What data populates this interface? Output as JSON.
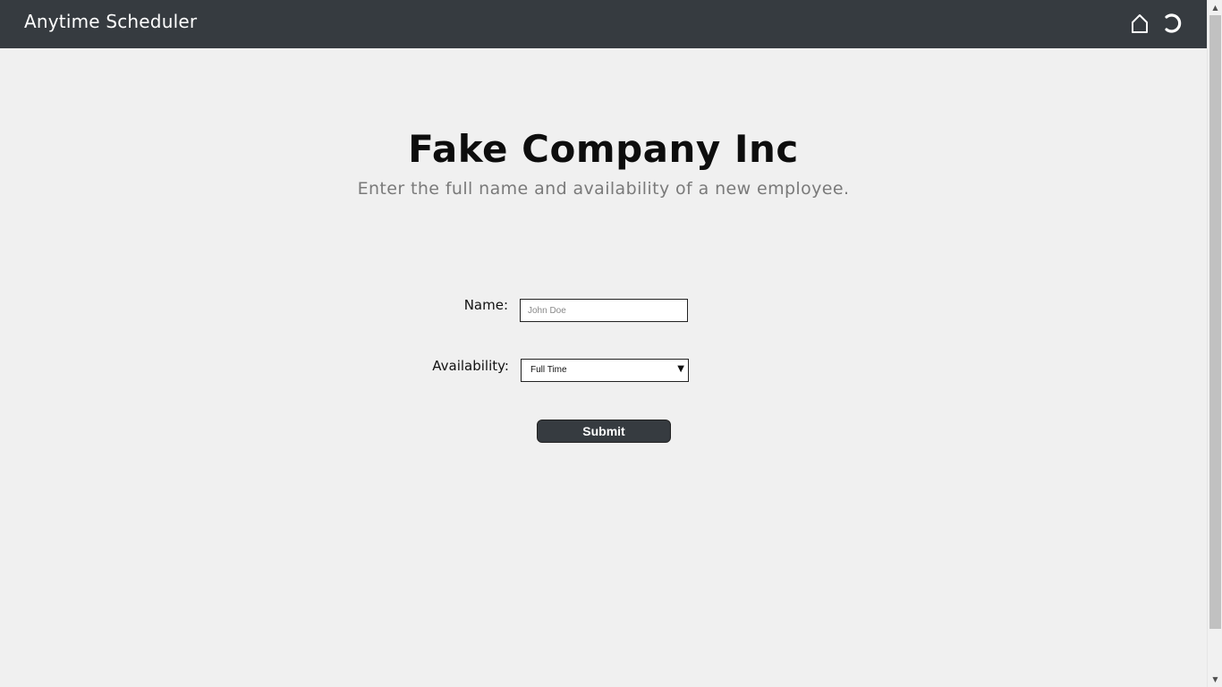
{
  "navbar": {
    "brand": "Anytime Scheduler",
    "icons": [
      "home-icon",
      "logout-icon"
    ]
  },
  "main": {
    "title": "Fake Company Inc",
    "subtitle": "Enter the full name and availability of a new employee."
  },
  "form": {
    "name_label": "Name:",
    "name_placeholder": "John Doe",
    "name_value": "",
    "availability_label": "Availability:",
    "availability_selected": "Full Time",
    "submit_label": "Submit"
  },
  "colors": {
    "navbar_bg": "#363b40",
    "page_bg": "#f0f0f0",
    "subtitle_text": "#7a7a7a"
  }
}
